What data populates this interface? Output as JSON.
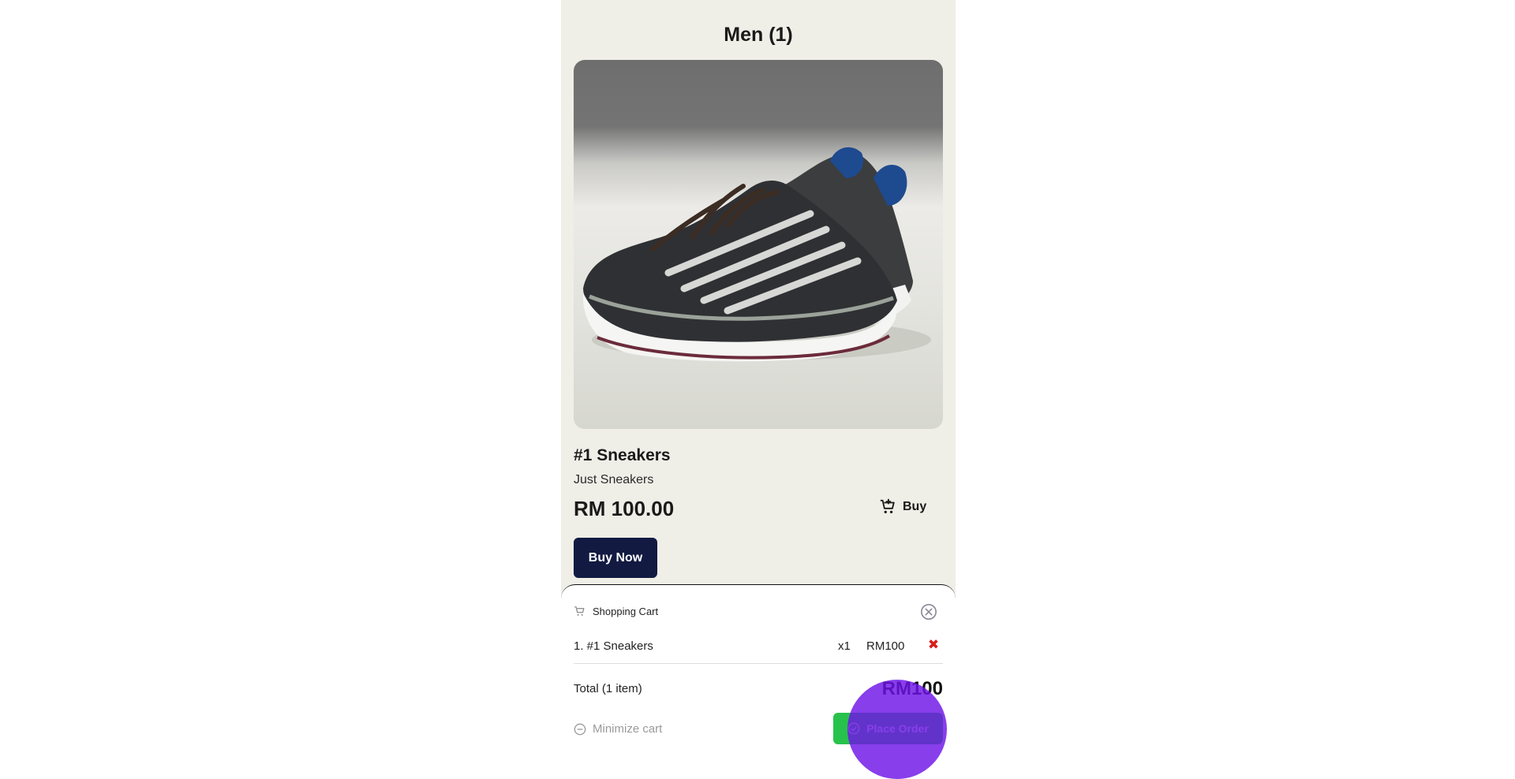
{
  "page": {
    "title": "Men (1)"
  },
  "product": {
    "name": "#1 Sneakers",
    "subtitle": "Just Sneakers",
    "price": "RM 100.00",
    "buy_label": "Buy",
    "buy_now_label": "Buy Now",
    "image_icon": "sneaker-photo"
  },
  "cart": {
    "title": "Shopping Cart",
    "items": [
      {
        "label": "1. #1 Sneakers",
        "qty": "x1",
        "price": "RM100",
        "remove_glyph": "✖"
      }
    ],
    "total_label": "Total (1 item)",
    "total_value": "RM100",
    "minimize_label": "Minimize cart",
    "place_order_label": "Place Order"
  },
  "colors": {
    "page_bg": "#efeee7",
    "buy_now_bg": "#121a42",
    "place_order_bg": "#27c24c",
    "remove_color": "#d91c1c",
    "touch_indicator": "#6e14e6"
  }
}
